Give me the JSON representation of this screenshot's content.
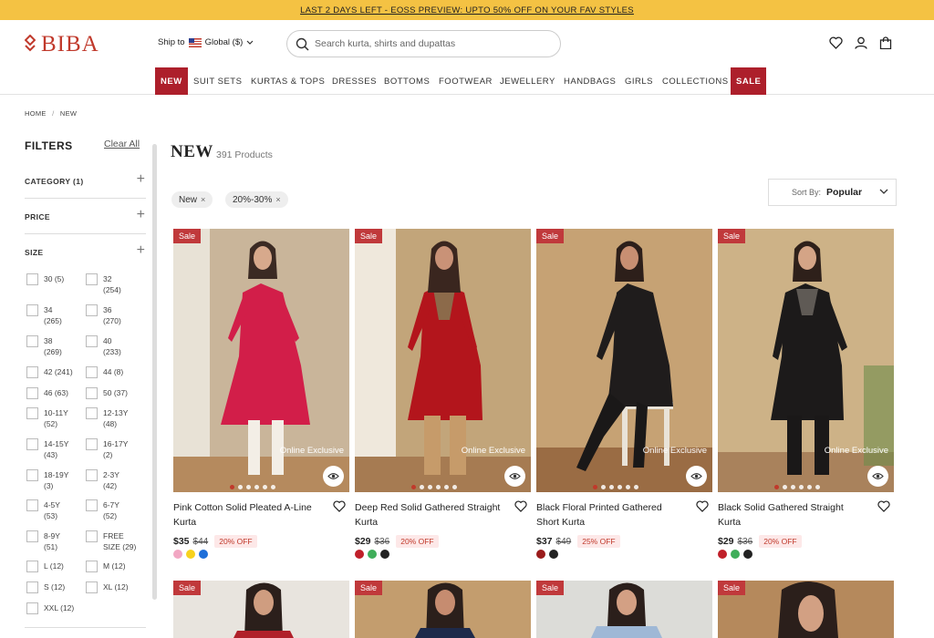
{
  "promo": {
    "text": "LAST 2 DAYS LEFT - EOSS PREVIEW: UPTO 50% OFF ON YOUR FAV STYLES"
  },
  "header": {
    "logo": "BIBA",
    "ship_to": "Ship to",
    "region": "Global ($)",
    "search_placeholder": "Search kurta, shirts and dupattas"
  },
  "nav": {
    "items": [
      "NEW",
      "SUIT SETS",
      "KURTAS & TOPS",
      "DRESSES",
      "BOTTOMS",
      "FOOTWEAR",
      "JEWELLERY",
      "HANDBAGS",
      "GIRLS",
      "COLLECTIONS",
      "SALE"
    ]
  },
  "breadcrumb": {
    "home": "HOME",
    "sep": "/",
    "current": "NEW"
  },
  "filters": {
    "title": "FILTERS",
    "clear": "Clear All",
    "sections": [
      "CATEGORY (1)",
      "PRICE",
      "SIZE"
    ],
    "sizes": [
      [
        "30 (5)",
        "32",
        "(254)"
      ],
      [
        "34",
        "(265)",
        "36",
        "(270)"
      ],
      [
        "38",
        "(269)",
        "40",
        "(233)"
      ],
      [
        "42 (241)",
        "44 (8)"
      ],
      [
        "46 (63)",
        "50 (37)"
      ],
      [
        "10-11Y",
        "(52)",
        "12-13Y",
        "(48)"
      ],
      [
        "14-15Y",
        "(43)",
        "16-17Y",
        "(2)"
      ],
      [
        "18-19Y",
        "(3)",
        "2-3Y",
        "(42)"
      ],
      [
        "4-5Y",
        "(53)",
        "6-7Y",
        "(52)"
      ],
      [
        "8-9Y",
        "(51)",
        "FREE",
        "SIZE (29)"
      ],
      [
        "L (12)",
        "M (12)"
      ],
      [
        "S (12)",
        "XL (12)"
      ],
      [
        "XXL (12)"
      ]
    ]
  },
  "listing": {
    "title": "NEW",
    "count": "391 Products",
    "chips": [
      "New",
      "20%-30%"
    ],
    "sort_label": "Sort By:",
    "sort_value": "Popular"
  },
  "products": [
    {
      "badge": "Sale",
      "tag": "Online Exclusive",
      "name": "Pink Cotton Solid Pleated A-Line Kurta",
      "price": "$35",
      "mrp": "$44",
      "off": "20% OFF",
      "swatches": [
        "#f2a7c3",
        "#f7d21e",
        "#1e6fd9"
      ]
    },
    {
      "badge": "Sale",
      "tag": "Online Exclusive",
      "name": "Deep Red Solid Gathered Straight Kurta",
      "price": "$29",
      "mrp": "$36",
      "off": "20% OFF",
      "swatches": [
        "#c0202a",
        "#3fae5a",
        "#222222"
      ]
    },
    {
      "badge": "Sale",
      "tag": "Online Exclusive",
      "name": "Black Floral Printed Gathered Short Kurta",
      "price": "$37",
      "mrp": "$49",
      "off": "25% OFF",
      "swatches": [
        "#9a1b1b",
        "#222222"
      ]
    },
    {
      "badge": "Sale",
      "tag": "Online Exclusive",
      "name": "Black Solid Gathered Straight Kurta",
      "price": "$29",
      "mrp": "$36",
      "off": "20% OFF",
      "swatches": [
        "#c0202a",
        "#3fae5a",
        "#222222"
      ]
    },
    {
      "badge": "Sale"
    },
    {
      "badge": "Sale"
    },
    {
      "badge": "Sale"
    },
    {
      "badge": "Sale"
    }
  ]
}
